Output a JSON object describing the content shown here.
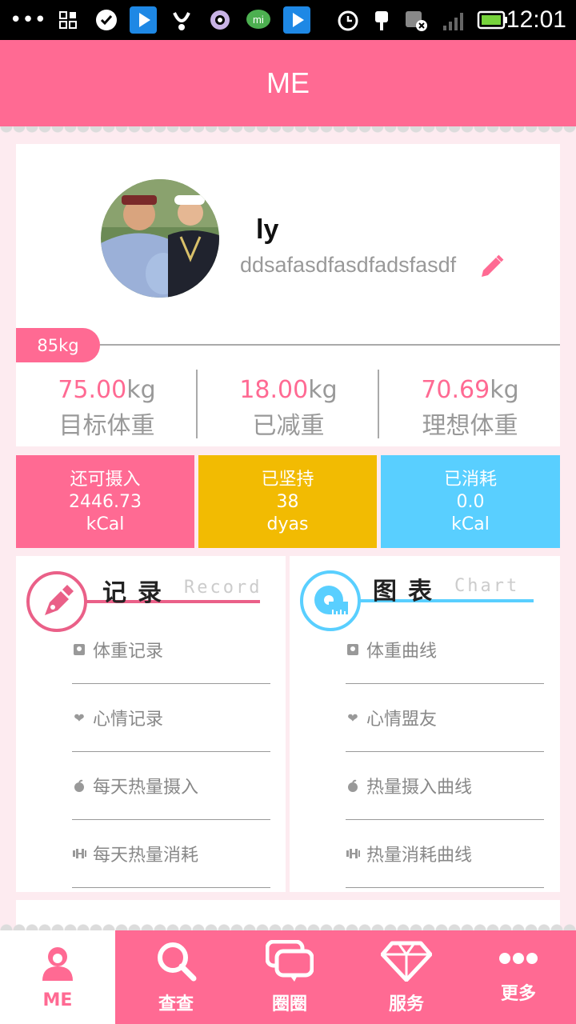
{
  "status_bar": {
    "time": "12:01"
  },
  "header": {
    "title": "ME"
  },
  "profile": {
    "name": "ly",
    "signature": "ddsafasdfasdfadsfasdf",
    "current_weight": "85kg"
  },
  "stats": [
    {
      "value": "75.00",
      "unit": "kg",
      "label": "目标体重"
    },
    {
      "value": "18.00",
      "unit": "kg",
      "label": "已减重"
    },
    {
      "value": "70.69",
      "unit": "kg",
      "label": "理想体重"
    }
  ],
  "tiles": [
    {
      "title": "还可摄入",
      "value": "2446.73",
      "unit": "kCal",
      "color": "#ff6a93"
    },
    {
      "title": "已坚持",
      "value": "38",
      "unit": "dyas",
      "color": "#f2bb02"
    },
    {
      "title": "已消耗",
      "value": "0.0",
      "unit": "kCal",
      "color": "#59cfff"
    }
  ],
  "record": {
    "title": "记录",
    "subtitle": "Record",
    "color": "#ea6088",
    "items": [
      {
        "icon": "scale-icon",
        "label": "体重记录"
      },
      {
        "icon": "heart-icon",
        "label": "心情记录"
      },
      {
        "icon": "apple-icon",
        "label": "每天热量摄入"
      },
      {
        "icon": "dumbbell-icon",
        "label": "每天热量消耗"
      }
    ]
  },
  "chart": {
    "title": "图表",
    "subtitle": "Chart",
    "color": "#59cfff",
    "items": [
      {
        "icon": "scale-icon",
        "label": "体重曲线"
      },
      {
        "icon": "heart-icon",
        "label": "心情盟友"
      },
      {
        "icon": "apple-icon",
        "label": "热量摄入曲线"
      },
      {
        "icon": "dumbbell-icon",
        "label": "热量消耗曲线"
      }
    ]
  },
  "bottom_nav": [
    {
      "label": "ME",
      "icon": "person-icon",
      "active": true
    },
    {
      "label": "查查",
      "icon": "search-icon",
      "active": false
    },
    {
      "label": "圈圈",
      "icon": "chat-icon",
      "active": false
    },
    {
      "label": "服务",
      "icon": "diamond-icon",
      "active": false
    },
    {
      "label": "更多",
      "icon": "more-icon",
      "active": false
    }
  ]
}
